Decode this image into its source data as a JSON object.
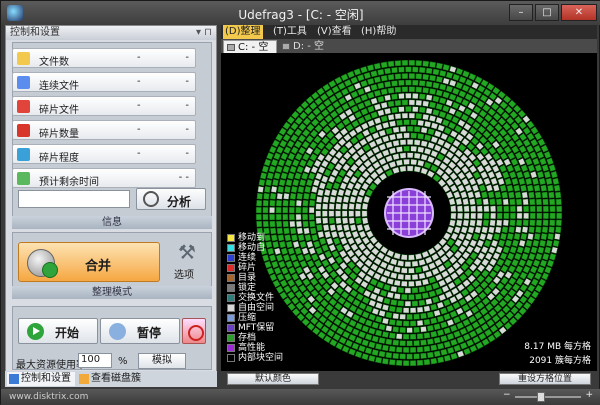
{
  "window": {
    "title": "Udefrag3 - [C: - 空闲]",
    "min": "–",
    "max": "□",
    "close": "✕"
  },
  "left_panel": {
    "header": "控制和设置",
    "pin_glyph": "▾ ⊓",
    "stats": [
      {
        "label": "文件数",
        "v1": "-",
        "v2": "-",
        "icon_color": "#f2c94c",
        "icon": "files-icon"
      },
      {
        "label": "连续文件",
        "v1": "-",
        "v2": "-",
        "icon_color": "#5b8def",
        "icon": "contiguous-icon"
      },
      {
        "label": "碎片文件",
        "v1": "-",
        "v2": "-",
        "icon_color": "#e0443a",
        "icon": "fragmented-icon"
      },
      {
        "label": "碎片数量",
        "v1": "-",
        "v2": "-",
        "icon_color": "#d9362b",
        "icon": "fragments-count-icon"
      },
      {
        "label": "碎片程度",
        "v1": "-",
        "v2": "-",
        "icon_color": "#3aa0d8",
        "icon": "fragment-level-icon"
      },
      {
        "label": "预计剩余时间",
        "v1": "",
        "v2": "- -",
        "icon_color": "#5cb85c",
        "icon": "clock-icon"
      }
    ],
    "analyze_label": "分析",
    "info_label": "信息",
    "defrag_label": "合并",
    "options_label": "选项",
    "mode_label": "整理模式",
    "start_label": "开始",
    "pause_label": "暂停",
    "resource_label": "最大资源使用率",
    "resource_value": "100",
    "resource_unit": "%",
    "simulate_label": "模拟",
    "tabs": [
      "控制和设置",
      "查看磁盘簇"
    ]
  },
  "menu": [
    {
      "label": "(D)整理",
      "active": true
    },
    {
      "label": "(T)工具",
      "active": false
    },
    {
      "label": "(V)查看",
      "active": false
    },
    {
      "label": "(H)帮助",
      "active": false
    }
  ],
  "drive_tabs": [
    {
      "label": "C: - 空闲",
      "active": true
    },
    {
      "label": "D: - 空闲",
      "active": false
    }
  ],
  "legend": [
    {
      "label": "移动到",
      "color": "#f5e642"
    },
    {
      "label": "移动自",
      "color": "#34e0e8"
    },
    {
      "label": "连续",
      "color": "#2a3fd6"
    },
    {
      "label": "碎片",
      "color": "#e02a2a"
    },
    {
      "label": "目录",
      "color": "#a8662a"
    },
    {
      "label": "锁定",
      "color": "#7a7a7a"
    },
    {
      "label": "交换文件",
      "color": "#2e7d7d"
    },
    {
      "label": "自由空间",
      "color": "#d8d8d8"
    },
    {
      "label": "压缩",
      "color": "#7a9ad8"
    },
    {
      "label": "MFT保留",
      "color": "#6a3fc8"
    },
    {
      "label": "存档",
      "color": "#2aa02a"
    },
    {
      "label": "高性能",
      "color": "#9a2ad8"
    },
    {
      "label": "内部块空间",
      "color": "#000000"
    }
  ],
  "stat_right": {
    "line1": "8.17 MB 每方格",
    "line2": "2091 簇每方格"
  },
  "bottom": {
    "default_colors": "默认颜色",
    "reset_block_pos": "重设方格位置"
  },
  "status": {
    "url": "www.disktrix.com"
  },
  "colors": {
    "used": "#22a822",
    "free": "#d9d9d9",
    "grid": "#0a5a0a",
    "center": "#8a3fd8"
  }
}
